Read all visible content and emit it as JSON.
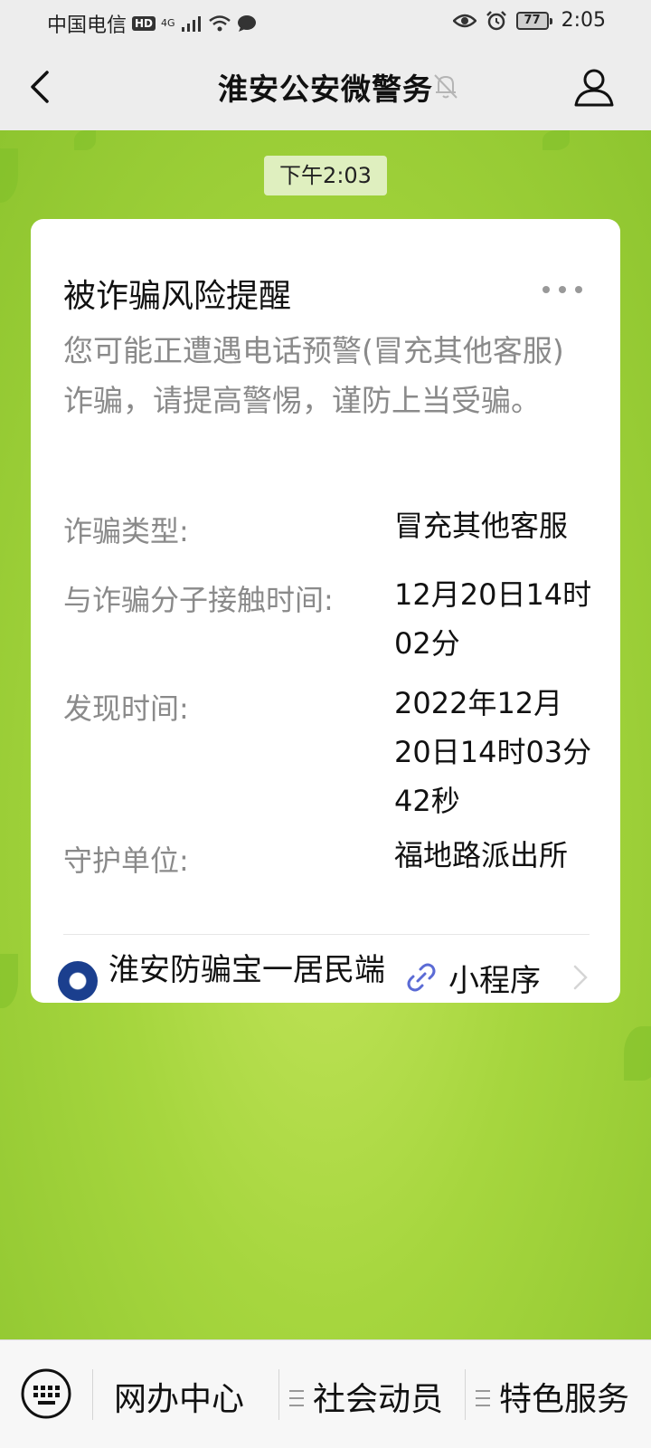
{
  "status_bar": {
    "carrier": "中国电信",
    "hd_badge": "HD",
    "network_type": "4G",
    "battery_level": "77",
    "time": "2:05"
  },
  "header": {
    "title": "淮安公安微警务"
  },
  "chat": {
    "timestamp": "下午2:03",
    "card": {
      "title": "被诈骗风险提醒",
      "description": "您可能正遭遇电话预警(冒充其他客服)诈骗，请提高警惕，谨防上当受骗。",
      "fields": [
        {
          "label": "诈骗类型:",
          "value": "冒充其他客服"
        },
        {
          "label": "与诈骗分子接触时间:",
          "value": "12月20日14时02分"
        },
        {
          "label": "发现时间:",
          "value": "2022年12月20日14时03分42秒"
        },
        {
          "label": "守护单位:",
          "value": "福地路派出所"
        }
      ],
      "mini_program": {
        "name": "淮安防骗宝一居民端",
        "tag": "小程序"
      }
    }
  },
  "bottom_menu": {
    "items": [
      {
        "label": "网办中心"
      },
      {
        "label": "社会动员"
      },
      {
        "label": "特色服务"
      }
    ]
  },
  "icons": {
    "back": "chevron-left-icon",
    "mute": "bell-muted-icon",
    "profile": "person-icon",
    "more": "ellipsis-icon",
    "mini_link": "link-icon",
    "keyboard": "keyboard-icon"
  },
  "colors": {
    "chat_background": "#a6d63e",
    "mini_logo": "#1b3f8e"
  }
}
